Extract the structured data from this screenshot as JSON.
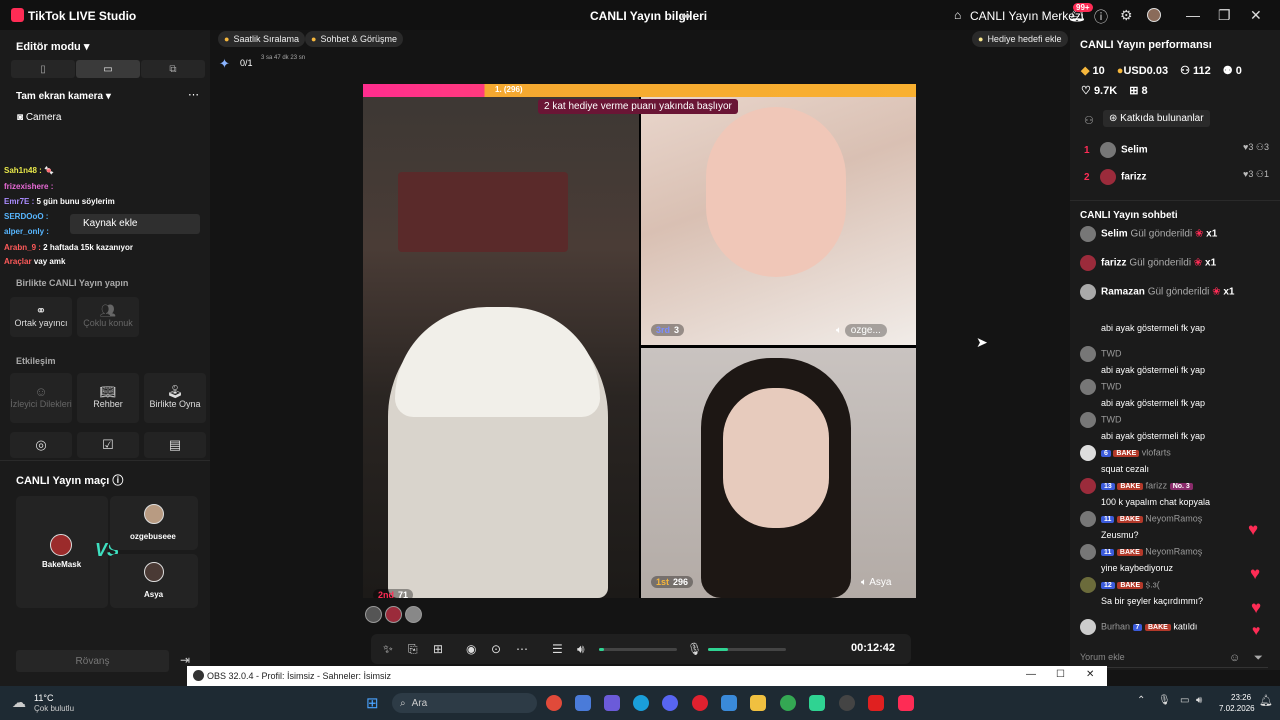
{
  "app": {
    "title": "TikTok LIVE Studio",
    "center_title": "CANLI Yayın bilgileri",
    "live_center": "CANLI Yayın Merkezi",
    "notif_count": "99+"
  },
  "left": {
    "editor_mode": "Editör modu",
    "fullscreen_camera": "Tam ekran kamera",
    "camera": "Camera",
    "add_source": "Kaynak ekle",
    "chat_overlay": [
      {
        "user": "Sah1n48 :",
        "text": "🍬",
        "color": "#e8e84a"
      },
      {
        "user": "frizexishere :",
        "text": "",
        "color": "#e86ad6"
      },
      {
        "user": "Emr7E :",
        "text": "5 gün bunu söylerim",
        "color": "#aa8cff"
      },
      {
        "user": "SERDOoO :",
        "text": "",
        "color": "#57b6ff"
      },
      {
        "user": "alper_only :",
        "text": "",
        "color": "#57b6ff"
      },
      {
        "user": "Arabn_9 :",
        "text": "2 haftada 15k kazanıyor",
        "color": "#ff5a5a"
      },
      {
        "user": "Araçlar",
        "text": "vay amk",
        "color": "#ff5a5a"
      }
    ],
    "live_together": "Birlikte CANLI Yayın yapın",
    "cohost": "Ortak yayıncı",
    "multi_guest": "Çoklu konuk",
    "interaction": "Etkileşim",
    "viewer_wishes": "İzleyici Dilekleri",
    "guide": "Rehber",
    "play_together": "Birlikte Oyna",
    "match_title": "CANLI Yayın maçı",
    "p1": "BakeMask",
    "p2": "ozgebuseee",
    "p3": "Asya",
    "rematch": "Rövanş"
  },
  "center": {
    "hourly_ranking": "Saatlik Sıralama",
    "chat_meet": "Sohbet & Görüşme",
    "gift_goal": "Hediye hedefi ekle",
    "goal_count": "0/1",
    "goal_timer": "3 sa 47 dk 23 sn",
    "rank1": "1. (296)",
    "banner": "2 kat hediye verme puanı yakında başlıyor",
    "third_label": "3rd",
    "third_score": "3",
    "third_name": "ozge...",
    "second_label": "2nd",
    "second_score": "71",
    "first_label": "1st",
    "first_score": "296",
    "first_name": "Asya",
    "timer": "00:12:42",
    "mic_level": 0.25,
    "speaker_level": 0.07
  },
  "right": {
    "perf_title": "CANLI Yayın performansı",
    "stat_diamonds": "10",
    "stat_usd": "USD0.03",
    "stat_viewers": "112",
    "stat_new": "0",
    "stat_likes": "9.7K",
    "stat_gifts": "8",
    "contributors_btn": "Katkıda bulunanlar",
    "contributors": [
      {
        "rank": "1",
        "name": "Selim",
        "hearts": "3",
        "subs": "3"
      },
      {
        "rank": "2",
        "name": "farizz",
        "hearts": "3",
        "subs": "1"
      }
    ],
    "chat_title": "CANLI Yayın sohbeti",
    "gifts": [
      {
        "name": "Selim",
        "action": "Gül gönderildi",
        "count": "x1"
      },
      {
        "name": "farizz",
        "action": "Gül gönderildi",
        "count": "x1"
      },
      {
        "name": "Ramazan",
        "action": "Gül gönderildi",
        "count": "x1"
      }
    ],
    "messages": [
      {
        "user": "TWD",
        "text": "abi ayak göstermeli fk yap"
      },
      {
        "user": "TWD",
        "text": "abi ayak göstermeli fk yap"
      },
      {
        "user": "TWD",
        "text": "abi ayak göstermeli fk yap"
      },
      {
        "user": "TWD",
        "text": "abi ayak göstermeli fk yap"
      },
      {
        "user": "vlofarts",
        "level": "6",
        "fan": "BAKE",
        "text": "squat cezalı"
      },
      {
        "user": "farizz",
        "level": "13",
        "fan": "BAKE",
        "extra": "No. 3",
        "text": "100 k yapalım chat kopyala"
      },
      {
        "user": "NeyomRamoş",
        "level": "11",
        "fan": "BAKE",
        "text": "Zeusmu?"
      },
      {
        "user": "NeyomRamoş",
        "level": "11",
        "fan": "BAKE",
        "text": "yine kaybediyoruz"
      },
      {
        "user": "ṩ.ɜ(",
        "level": "12",
        "fan": "BAKE",
        "text": "Sa bir şeyler kaçırdımmı?"
      },
      {
        "user": "Burhan",
        "level": "7",
        "fan": "BAKE",
        "text": "katıldı"
      }
    ],
    "chat_placeholder": "Yorum ekle"
  },
  "obs": {
    "title": "OBS 32.0.4 - Profil: İsimsiz - Sahneler: İsimsiz"
  },
  "taskbar": {
    "temp": "11°C",
    "weather": "Çok bulutlu",
    "search": "Ara",
    "time": "23:26",
    "date": "7.02.2026"
  }
}
